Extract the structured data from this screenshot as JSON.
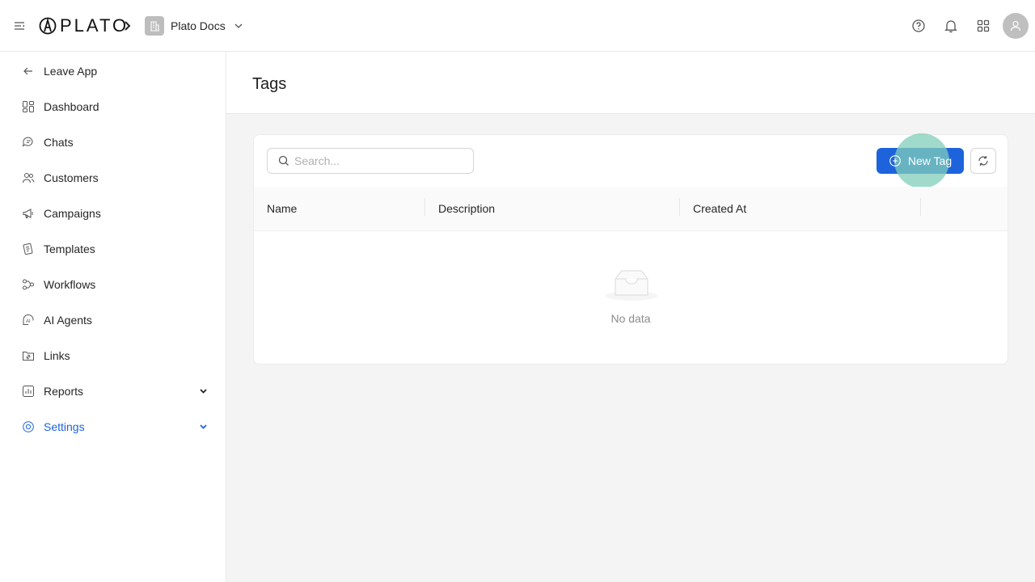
{
  "app": {
    "logo_text": "PLATO",
    "workspace_name": "Plato Docs"
  },
  "colors": {
    "accent": "#1d63dc",
    "active_nav": "#1d63dc",
    "ripple": "#80ceba"
  },
  "header_icons": [
    "help-icon",
    "bell-icon",
    "apps-grid-icon",
    "user-avatar-icon"
  ],
  "sidebar": {
    "items": [
      {
        "label": "Leave App",
        "icon": "arrow-left-icon"
      },
      {
        "label": "Dashboard",
        "icon": "dashboard-icon"
      },
      {
        "label": "Chats",
        "icon": "chat-icon"
      },
      {
        "label": "Customers",
        "icon": "users-icon"
      },
      {
        "label": "Campaigns",
        "icon": "megaphone-icon"
      },
      {
        "label": "Templates",
        "icon": "template-icon"
      },
      {
        "label": "Workflows",
        "icon": "workflow-icon"
      },
      {
        "label": "AI Agents",
        "icon": "ai-agent-icon"
      },
      {
        "label": "Links",
        "icon": "link-icon"
      },
      {
        "label": "Reports",
        "icon": "chart-icon",
        "expandable": true
      },
      {
        "label": "Settings",
        "icon": "settings-icon",
        "expandable": true,
        "active": true
      }
    ]
  },
  "page": {
    "title": "Tags"
  },
  "toolbar": {
    "search_placeholder": "Search...",
    "search_value": "",
    "new_tag_label": "New Tag"
  },
  "table": {
    "columns": [
      "Name",
      "Description",
      "Created At",
      ""
    ],
    "rows": [],
    "empty_text": "No data"
  }
}
